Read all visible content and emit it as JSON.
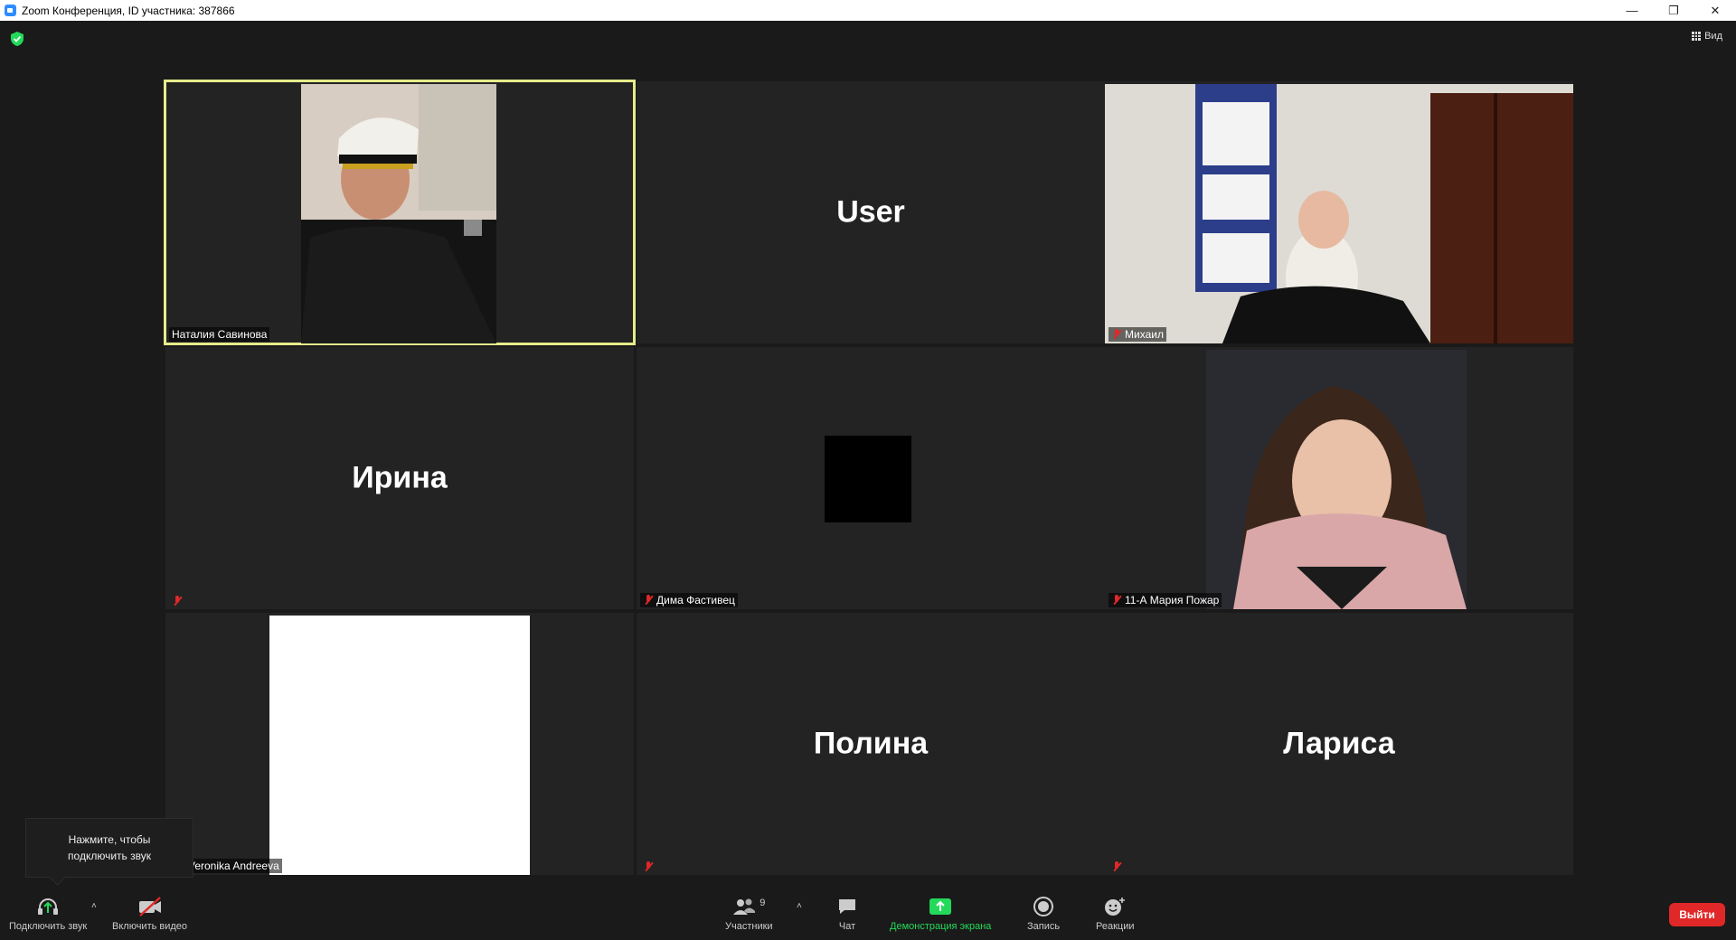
{
  "window": {
    "title": "Zoom Конференция, ID участника: 387866",
    "minimize": "—",
    "restore": "❐",
    "close": "✕"
  },
  "view_button": {
    "label": "Вид"
  },
  "tiles": [
    {
      "name": "Наталия Савинова",
      "muted": false,
      "active": true,
      "video": true
    },
    {
      "name": "User",
      "display_name": "User",
      "label": "",
      "muted": false
    },
    {
      "name": "Михаил",
      "muted": true,
      "video": true
    },
    {
      "name": "Ирина",
      "display_name": "Ирина",
      "label": "",
      "muted": true
    },
    {
      "name": "Дима Фастивец",
      "muted": true,
      "video": true
    },
    {
      "name": "11-А Мария Пожар",
      "muted": true,
      "video": true
    },
    {
      "name": "Veronika Andreeva",
      "muted": false,
      "video": true
    },
    {
      "name": "Полина",
      "display_name": "Полина",
      "label": "",
      "muted": true
    },
    {
      "name": "Лариса",
      "display_name": "Лариса",
      "label": "",
      "muted": true
    }
  ],
  "tooltip": {
    "text": "Нажмите, чтобы подключить звук"
  },
  "toolbar": {
    "audio_label": "Подключить звук",
    "video_label": "Включить видео",
    "participants_label": "Участники",
    "participants_count": "9",
    "chat_label": "Чат",
    "share_label": "Демонстрация экрана",
    "record_label": "Запись",
    "reactions_label": "Реакции",
    "leave_label": "Выйти"
  },
  "colors": {
    "accent_green": "#23d959",
    "active_speaker": "#e6ec8a",
    "leave_red": "#e02828",
    "muted_red": "#e02828"
  }
}
